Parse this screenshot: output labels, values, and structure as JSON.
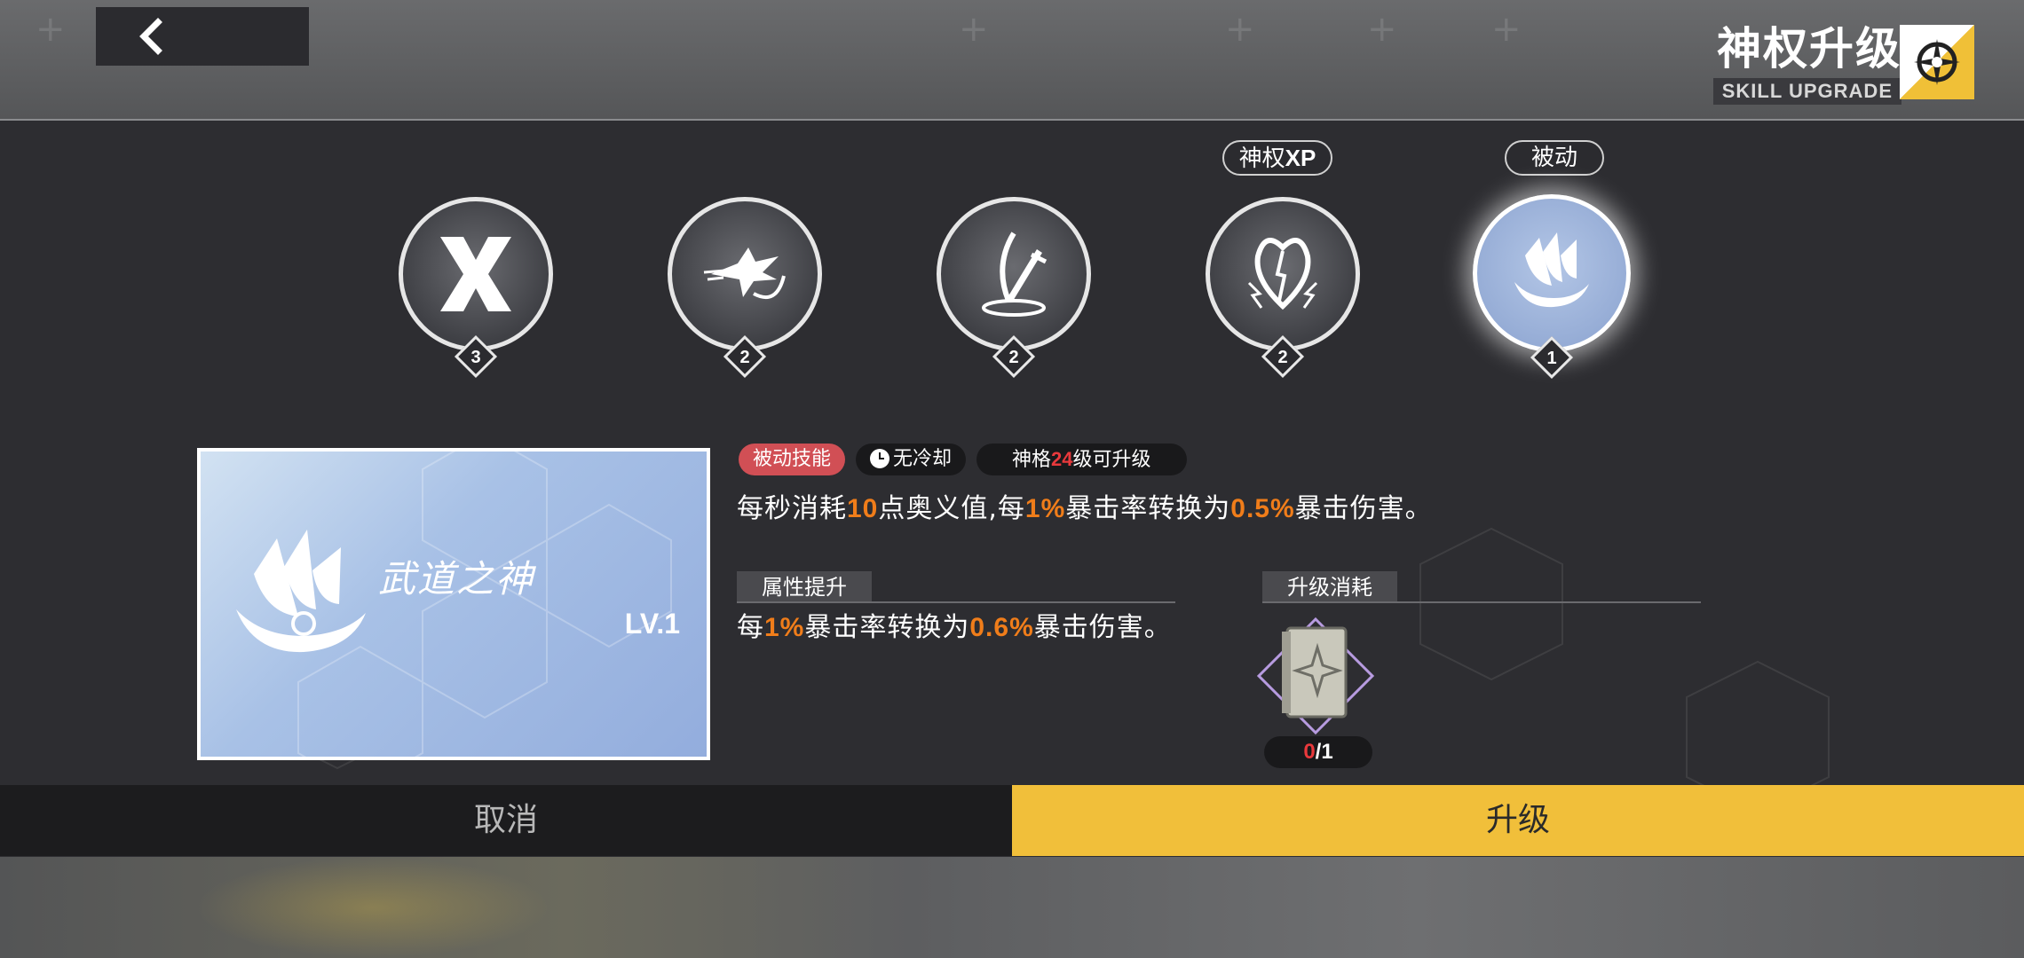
{
  "header": {
    "back_icon": "chevron-left-icon",
    "title_cn": "神权升级",
    "title_en": "SKILL UPGRADE",
    "title_badge_icon": "compass-star-icon"
  },
  "skills": [
    {
      "icon": "x-slash-skill-icon",
      "level": "3",
      "tag": ""
    },
    {
      "icon": "dash-strike-skill-icon",
      "level": "2",
      "tag": ""
    },
    {
      "icon": "sword-ground-skill-icon",
      "level": "2",
      "tag": ""
    },
    {
      "icon": "thunder-crown-skill-icon",
      "level": "2",
      "tag_prefix": "神权",
      "tag_suffix": "XP"
    },
    {
      "icon": "claw-passive-skill-icon",
      "level": "1",
      "tag": "被动",
      "selected": true
    }
  ],
  "card": {
    "name": "武道之神",
    "level": "LV.1",
    "icon": "claw-passive-skill-icon"
  },
  "tags": {
    "passive_label": "被动技能",
    "cooldown_label": "无冷却",
    "unlock_prefix": "神格",
    "unlock_level": "24",
    "unlock_suffix": "级可升级"
  },
  "description": {
    "p1": "每秒消耗",
    "v1": "10",
    "p2": "点奥义值,每",
    "v2": "1%",
    "p3": "暴击率转换为",
    "v3": "0.5%",
    "p4": "暴击伤害。"
  },
  "attribute": {
    "heading": "属性提升",
    "p1": "每",
    "v1": "1%",
    "p2": "暴击率转换为",
    "v2": "0.6%",
    "p3": "暴击伤害。"
  },
  "cost": {
    "heading": "升级消耗",
    "item_icon": "skill-book-icon",
    "have": "0",
    "need": "/1"
  },
  "buttons": {
    "cancel": "取消",
    "upgrade": "升级"
  },
  "colors": {
    "accent": "#f1bf3a",
    "passive_tag": "#d14f55",
    "highlight_orange": "#f07d1a",
    "highlight_red": "#e9393c"
  }
}
